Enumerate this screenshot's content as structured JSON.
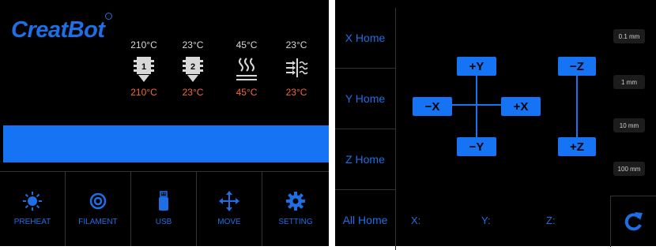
{
  "status": {
    "logo": "CreatBot",
    "temperatures": [
      {
        "target": "210°C",
        "current": "210°C",
        "icon": "extruder-1-icon"
      },
      {
        "target": "23°C",
        "current": "23°C",
        "icon": "extruder-2-icon"
      },
      {
        "target": "45°C",
        "current": "45°C",
        "icon": "heated-bed-icon"
      },
      {
        "target": "23°C",
        "current": "23°C",
        "icon": "chamber-heat-icon"
      }
    ],
    "menu": [
      {
        "label": "PREHEAT",
        "icon": "sun-icon"
      },
      {
        "label": "FILAMENT",
        "icon": "spool-icon"
      },
      {
        "label": "USB",
        "icon": "usb-drive-icon"
      },
      {
        "label": "MOVE",
        "icon": "move-arrows-icon"
      },
      {
        "label": "SETTING",
        "icon": "gear-icon"
      }
    ]
  },
  "move": {
    "home": [
      "X Home",
      "Y Home",
      "Z Home",
      "All Home"
    ],
    "jog": {
      "plus_y": "+Y",
      "minus_y": "−Y",
      "minus_x": "−X",
      "plus_x": "+X",
      "minus_z": "−Z",
      "plus_z": "+Z"
    },
    "steps": [
      "0.1 mm",
      "1 mm",
      "10 mm",
      "100 mm"
    ],
    "coords": {
      "x": "X:",
      "y": "Y:",
      "z": "Z:"
    }
  },
  "colors": {
    "accent": "#1673f4",
    "text_blue": "#1e6fe6",
    "temp_current": "#f06a35"
  }
}
